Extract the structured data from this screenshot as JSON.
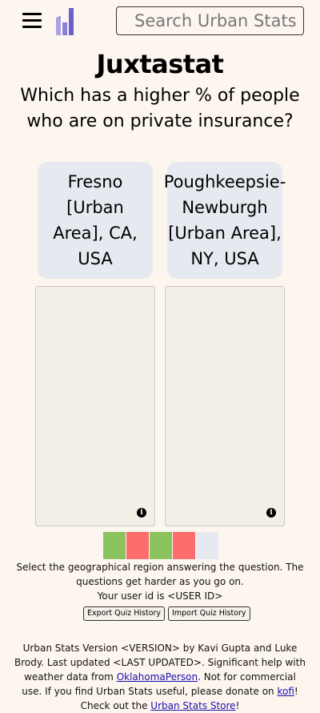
{
  "header": {
    "menu_icon": "hamburger-menu-icon",
    "logo_icon": "urban-stats-logo-icon",
    "search_placeholder": "Search Urban Stats"
  },
  "page": {
    "title": "Juxtastat",
    "question": "Which has a higher % of people who are on private insurance?"
  },
  "choices": [
    {
      "label": "Fresno [Urban Area], CA, USA"
    },
    {
      "label": "Poughkeepsie-Newburgh [Urban Area], NY, USA"
    }
  ],
  "maps": {
    "info_icon": "info-icon",
    "info_glyph": "i",
    "map_background": "#f2efe7"
  },
  "history": {
    "results": [
      "correct",
      "incorrect",
      "correct",
      "incorrect",
      "pending"
    ],
    "colors": {
      "correct": "#8ac35e",
      "incorrect": "#fc6d6d",
      "pending": "#e6e9ef"
    }
  },
  "instructions": {
    "text": "Select the geographical region answering the question. The questions get harder as you go on.",
    "user_id": "Your user id is <USER ID>"
  },
  "buttons": {
    "export": "Export Quiz History",
    "import": "Import Quiz History"
  },
  "footer": {
    "part1": "Urban Stats Version <VERSION> by Kavi Gupta and Luke Brody. Last updated <LAST UPDATED>. Significant help with weather data from ",
    "link1": "OklahomaPerson",
    "part2": ". Not for commercial use. If you find Urban Stats useful, please donate on ",
    "link2": "kofi",
    "part3": "! Check out the ",
    "link3": "Urban Stats Store",
    "part4": "!"
  },
  "colors": {
    "background": "#fdf6ef",
    "choice_background": "#e6e9ef",
    "logo_purple": "#8b82d6",
    "link": "#1a0dab"
  }
}
